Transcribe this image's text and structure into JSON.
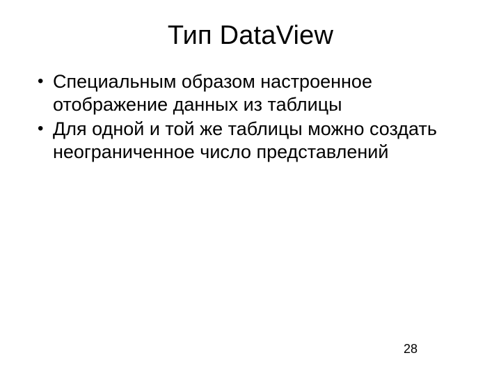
{
  "title": "Тип DataView",
  "bullets": [
    "Специальным образом настроенное отображение данных из таблицы",
    "Для одной и той же таблицы можно создать неограниченное число представлений"
  ],
  "page_number": "28"
}
